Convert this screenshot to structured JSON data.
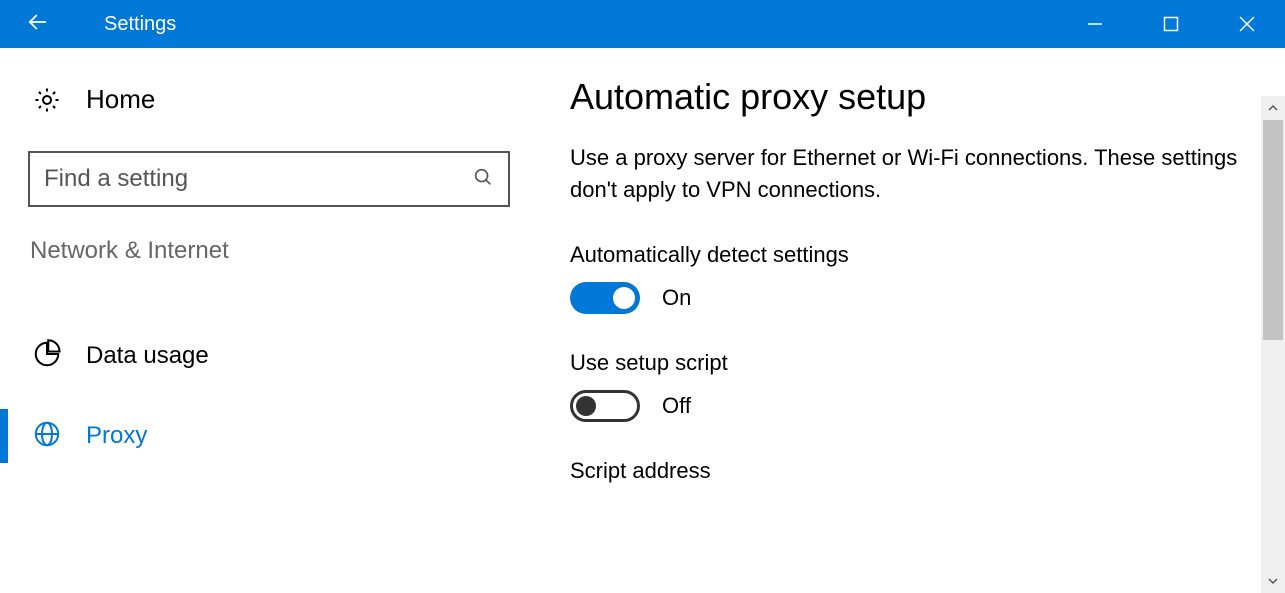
{
  "titlebar": {
    "title": "Settings"
  },
  "sidebar": {
    "home_label": "Home",
    "search_placeholder": "Find a setting",
    "category_label": "Network & Internet",
    "items": [
      {
        "label": "Data usage"
      },
      {
        "label": "Proxy"
      }
    ]
  },
  "main": {
    "section_title": "Automatic proxy setup",
    "section_desc": "Use a proxy server for Ethernet or Wi-Fi connections. These settings don't apply to VPN connections.",
    "auto_detect_label": "Automatically detect settings",
    "auto_detect_state": "On",
    "use_script_label": "Use setup script",
    "use_script_state": "Off",
    "script_address_label": "Script address"
  }
}
